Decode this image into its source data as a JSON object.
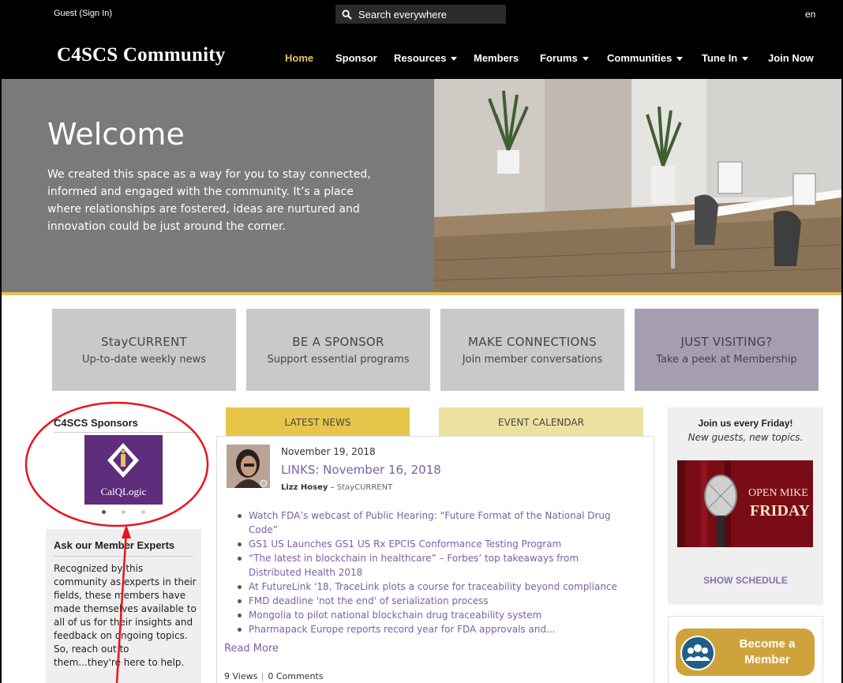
{
  "topbar": {
    "guest_label": "Guest (Sign In)",
    "search_placeholder": "Search everywhere",
    "language": "en"
  },
  "header": {
    "brand": "C4SCS Community",
    "nav": [
      {
        "label": "Home",
        "active": true,
        "dropdown": false
      },
      {
        "label": "Sponsor",
        "active": false,
        "dropdown": false
      },
      {
        "label": "Resources",
        "active": false,
        "dropdown": true
      },
      {
        "label": "Members",
        "active": false,
        "dropdown": false
      },
      {
        "label": "Forums",
        "active": false,
        "dropdown": true
      },
      {
        "label": "Communities",
        "active": false,
        "dropdown": true
      },
      {
        "label": "Tune In",
        "active": false,
        "dropdown": true
      },
      {
        "label": "Join Now",
        "active": false,
        "dropdown": false
      }
    ]
  },
  "hero": {
    "title": "Welcome",
    "body": "We created this space as a way for you to stay connected, informed and engaged with the community. It’s a place where relationships are fostered, ideas are nurtured and innovation could be just around the corner."
  },
  "tiles": [
    {
      "title": "StayCURRENT",
      "subtitle": "Up-to-date weekly news"
    },
    {
      "title": "BE A SPONSOR",
      "subtitle": "Support essential programs"
    },
    {
      "title": "MAKE CONNECTIONS",
      "subtitle": "Join member conversations"
    },
    {
      "title": "JUST VISITING?",
      "subtitle": "Take a peek at Membership"
    }
  ],
  "sponsors": {
    "title": "C4SCS Sponsors",
    "logo_name": "CalQLogic",
    "carousel_position": 1,
    "carousel_count": 3
  },
  "experts": {
    "title": "Ask our Member Experts",
    "body": "Recognized by this community as experts in their fields, these members have made themselves available to all of us for their insights and feedback on ongoing topics. So, reach out to them...they're here to help."
  },
  "news": {
    "tab_news": "LATEST NEWS",
    "tab_calendar": "EVENT CALENDAR",
    "date": "November 19, 2018",
    "title": "LINKS: November 16, 2018",
    "author": "Lizz Hosey",
    "source": "StayCURRENT",
    "links": [
      "Watch FDA’s webcast of Public Hearing: “Future Format of the National Drug Code”",
      "GS1 US Launches GS1 US Rx EPCIS Conformance Testing Program",
      "“The latest in blockchain in healthcare” – Forbes’ top takeaways from Distributed Health 2018",
      "At FutureLink '18, TraceLink plots a course for traceability beyond compliance",
      "FMD deadline 'not the end' of serialization process",
      "Mongolia to pilot national blockchain drug traceability system",
      "Pharmapack Europe reports record year for FDA approvals and..."
    ],
    "read_more": "Read More",
    "views": "9 Views",
    "comments": "0 Comments"
  },
  "friday": {
    "title": "Join us every Friday!",
    "subtitle": "New guests, new topics.",
    "image_text_1": "OPEN MIKE",
    "image_text_2": "FRIDAY",
    "link": "SHOW SCHEDULE"
  },
  "member_button": {
    "label_1": "Become a",
    "label_2": "Member"
  },
  "colors": {
    "accent_gold": "#e3c35a",
    "link_purple": "#7c5fa6",
    "sponsor_purple": "#5e2d7c",
    "annotation_red": "#e8141b"
  }
}
